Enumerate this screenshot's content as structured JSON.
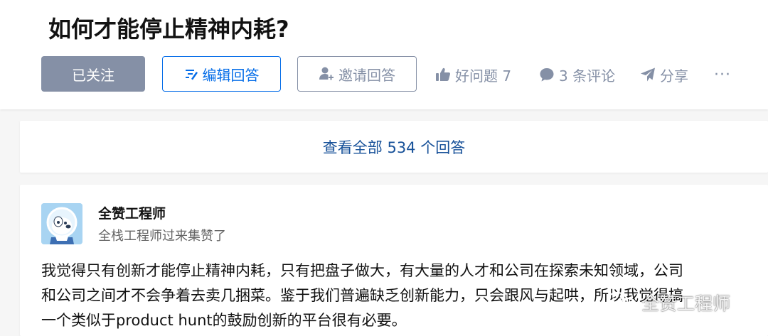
{
  "question": {
    "title": "如何才能停止精神内耗?"
  },
  "actions": {
    "follow_label": "已关注",
    "edit_label": "编辑回答",
    "invite_label": "邀请回答",
    "good_question_label": "好问题 7",
    "comments_label": "3 条评论",
    "share_label": "分享",
    "more_label": "···"
  },
  "icons": {
    "edit": "edit-icon",
    "invite": "add-user-icon",
    "good_question": "thumbs-up-icon",
    "comment": "comment-bubble-icon",
    "share": "paper-plane-icon",
    "more": "more-dots-icon"
  },
  "colors": {
    "primary_blue": "#056de8",
    "link_blue": "#175199",
    "muted_gray": "#8590a6",
    "followed_bg": "#8590a6"
  },
  "view_all": {
    "label": "查看全部 534 个回答"
  },
  "answer": {
    "author_name": "全赞工程师",
    "author_bio": "全栈工程师过来集赞了",
    "content_lines": [
      "我觉得只有创新才能停止精神内耗，只有把盘子做大，有大量的人才和公司在探索未知领域，公司",
      "和公司之间才不会争着去卖几捆菜。鉴于我们普遍缺乏创新能力，只会跟风与起哄，所以我觉得搞",
      "一个类似于product hunt的鼓励创新的平台很有必要。"
    ]
  },
  "watermark": {
    "text": "全赞工程师"
  }
}
